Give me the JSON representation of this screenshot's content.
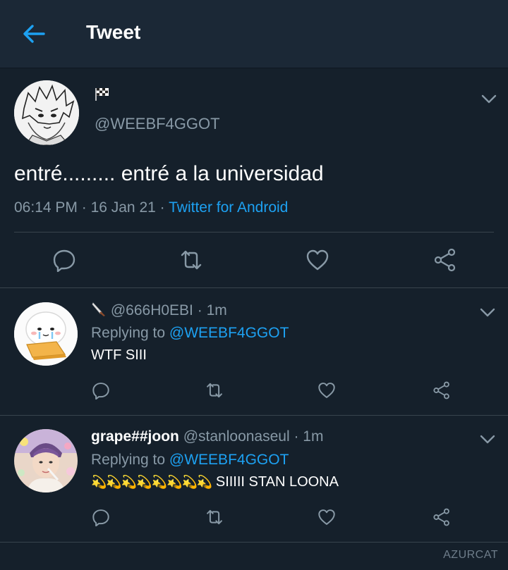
{
  "header": {
    "title": "Tweet",
    "back_icon": "arrow-left-icon",
    "accent": "#1da1f2"
  },
  "main_tweet": {
    "flag_icon": "checkered-flag-icon",
    "handle": "@WEEBF4GGOT",
    "text": "entré......... entré a la universidad",
    "time": "06:14 PM",
    "sep": " · ",
    "date": "16 Jan 21",
    "source": "Twitter for Android"
  },
  "replies": [
    {
      "emoji_icon": "knife-icon",
      "handle": "@666H0EBI",
      "time": " · 1m",
      "replying_label": "Replying to ",
      "replying_to": "@WEEBF4GGOT",
      "text": "WTF SIII"
    },
    {
      "name": "grape##joon",
      "handle": "@stanloonaseul",
      "time": " · 1m",
      "replying_label": "Replying to ",
      "replying_to": "@WEEBF4GGOT",
      "emojis": "💫💫💫💫💫💫💫💫",
      "text": " SIIIII STAN LOONA"
    }
  ],
  "watermark": "AZURCAT"
}
